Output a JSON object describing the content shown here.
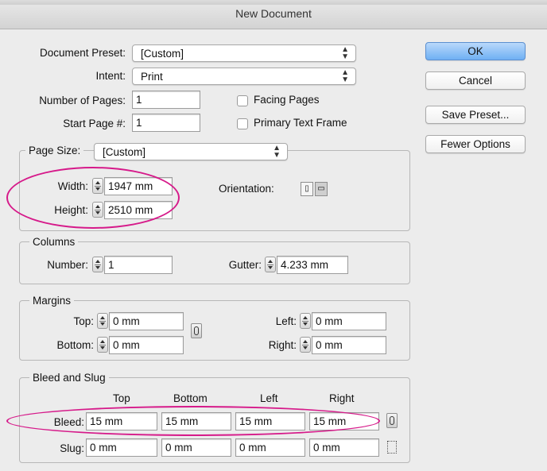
{
  "window": {
    "title": "New Document"
  },
  "top": {
    "document_preset_label": "Document Preset:",
    "document_preset_value": "[Custom]",
    "intent_label": "Intent:",
    "intent_value": "Print",
    "number_of_pages_label": "Number of Pages:",
    "number_of_pages_value": "1",
    "start_page_label": "Start Page #:",
    "start_page_value": "1",
    "facing_pages_label": "Facing Pages",
    "primary_text_frame_label": "Primary Text Frame"
  },
  "buttons": {
    "ok": "OK",
    "cancel": "Cancel",
    "save_preset": "Save Preset...",
    "fewer_options": "Fewer Options"
  },
  "page_size": {
    "label": "Page Size:",
    "value": "[Custom]",
    "width_label": "Width:",
    "width_value": "1947 mm",
    "height_label": "Height:",
    "height_value": "2510 mm",
    "orientation_label": "Orientation:"
  },
  "columns": {
    "legend": "Columns",
    "number_label": "Number:",
    "number_value": "1",
    "gutter_label": "Gutter:",
    "gutter_value": "4.233 mm"
  },
  "margins": {
    "legend": "Margins",
    "top_label": "Top:",
    "top_value": "0 mm",
    "bottom_label": "Bottom:",
    "bottom_value": "0 mm",
    "left_label": "Left:",
    "left_value": "0 mm",
    "right_label": "Right:",
    "right_value": "0 mm"
  },
  "bleed_slug": {
    "legend": "Bleed and Slug",
    "headers": [
      "Top",
      "Bottom",
      "Left",
      "Right"
    ],
    "bleed_label": "Bleed:",
    "bleed_values": [
      "15 mm",
      "15 mm",
      "15 mm",
      "15 mm"
    ],
    "slug_label": "Slug:",
    "slug_values": [
      "0 mm",
      "0 mm",
      "0 mm",
      "0 mm"
    ]
  },
  "colors": {
    "annotation": "#d61a8a",
    "primary_button": "#6fb0f3"
  },
  "icons": [
    "stepper-icon",
    "link-icon",
    "portrait-icon",
    "landscape-icon",
    "chain-broken-icon"
  ]
}
